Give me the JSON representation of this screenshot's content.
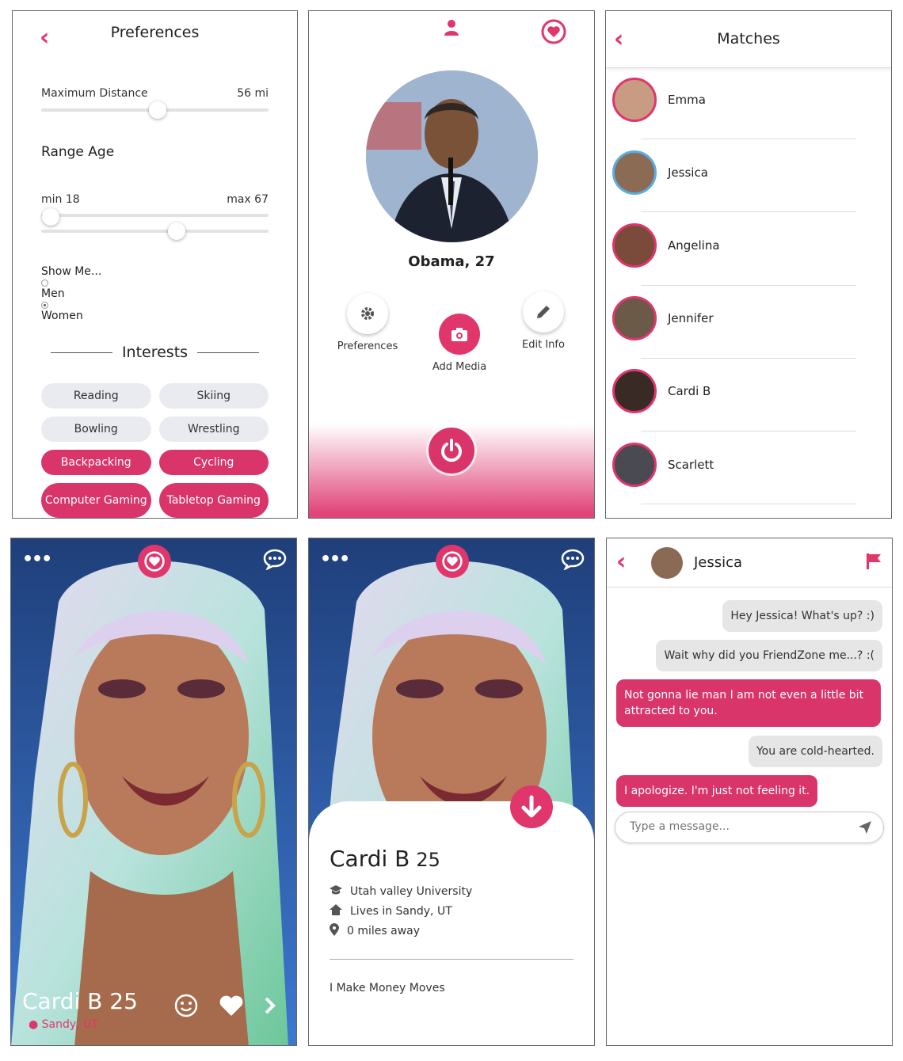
{
  "colors": {
    "accent": "#e0366b",
    "chip_bg": "#e9ebf0",
    "bubble_in": "#e6e6e6"
  },
  "preferences": {
    "title": "Preferences",
    "distance_label": "Maximum Distance",
    "distance_value": "56 mi",
    "distance_fraction": 0.51,
    "range_age_title": "Range Age",
    "age_min_label": "min 18",
    "age_max_label": "max 67",
    "age_min_fraction": 0.04,
    "age_max_fraction": 0.59,
    "show_me_label": "Show Me...",
    "show_options": [
      {
        "label": "Men",
        "selected": false
      },
      {
        "label": "Women",
        "selected": true
      }
    ],
    "interests_title": "Interests",
    "interests": [
      {
        "label": "Reading",
        "selected": false
      },
      {
        "label": "Skiing",
        "selected": false
      },
      {
        "label": "Bowling",
        "selected": false
      },
      {
        "label": "Wrestling",
        "selected": false
      },
      {
        "label": "Backpacking",
        "selected": true
      },
      {
        "label": "Cycling",
        "selected": true
      },
      {
        "label": "Computer Gaming",
        "selected": true
      },
      {
        "label": "Tabletop Gaming",
        "selected": true
      }
    ]
  },
  "profile": {
    "name": "Obama, 27",
    "preferences_label": "Preferences",
    "add_media_label": "Add Media",
    "edit_info_label": "Edit Info"
  },
  "matches": {
    "title": "Matches",
    "items": [
      {
        "name": "Emma"
      },
      {
        "name": "Jessica"
      },
      {
        "name": "Angelina"
      },
      {
        "name": "Jennifer"
      },
      {
        "name": "Cardi B"
      },
      {
        "name": "Scarlett"
      }
    ]
  },
  "card": {
    "name": "Cardi B",
    "age": "25",
    "location": "Sandy, UT"
  },
  "detail": {
    "name": "Cardi B",
    "age": "25",
    "school": "Utah valley University",
    "lives": "Lives in Sandy, UT",
    "distance": "0 miles away",
    "bio": "I Make Money Moves"
  },
  "chat": {
    "name": "Jessica",
    "messages": [
      {
        "from": "them",
        "text": "Hey Jessica! What's up? :)"
      },
      {
        "from": "them",
        "text": "Wait why did you FriendZone me...? :("
      },
      {
        "from": "me",
        "text": "Not gonna lie man I am not even a little bit attracted to you."
      },
      {
        "from": "them",
        "text": "You are cold-hearted."
      },
      {
        "from": "me",
        "text": "I apologize. I'm just not feeling it."
      }
    ],
    "input_placeholder": "Type a message..."
  }
}
